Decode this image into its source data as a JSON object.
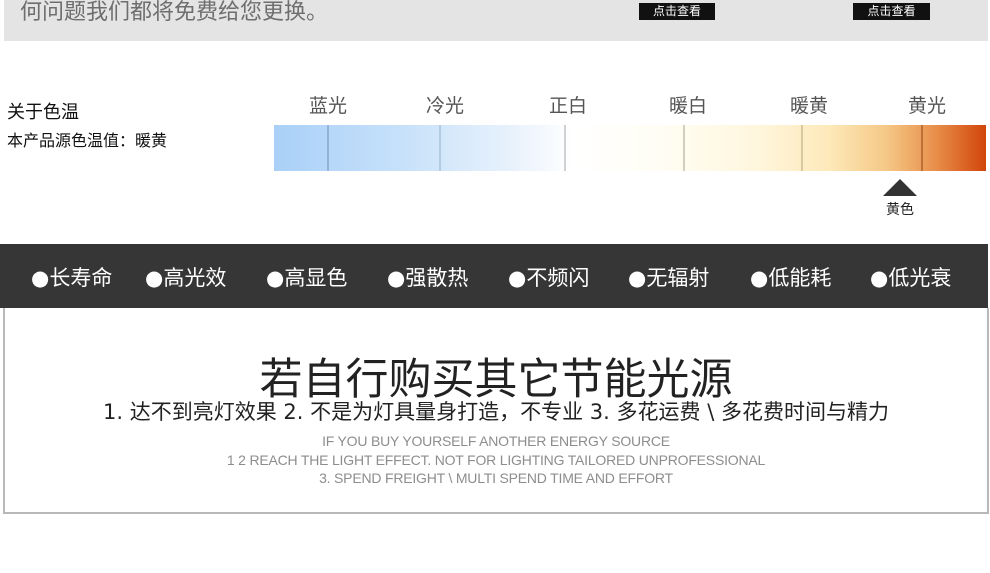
{
  "banner": {
    "text": "何问题我们都将免费给您更换。",
    "view_buttons": [
      "点击查看",
      "点击查看"
    ]
  },
  "color_temperature": {
    "title": "关于色温",
    "product_label": "本产品源色温值：暖黄",
    "labels": [
      "蓝光",
      "冷光",
      "正白",
      "暖白",
      "暖黄",
      "黄光"
    ],
    "marker_label": "黄色",
    "gradient_colors": [
      "#a9d0f8",
      "#ffffff",
      "#fde9b9",
      "#d1450a"
    ]
  },
  "features": [
    "●长寿命",
    "●高光效",
    "●高显色",
    "●强散热",
    "●不频闪",
    "●无辐射",
    "●低能耗",
    "●低光衰"
  ],
  "info": {
    "heading": "若自行购买其它节能光源",
    "points": "1. 达不到亮灯效果   2. 不是为灯具量身打造，不专业  3. 多花运费 \\ 多花费时间与精力",
    "english_lines": [
      "IF YOU BUY YOURSELF ANOTHER ENERGY SOURCE",
      "1 2 REACH THE LIGHT EFFECT. NOT FOR LIGHTING TAILORED UNPROFESSIONAL",
      "3. SPEND FREIGHT \\ MULTI SPEND TIME AND EFFORT"
    ]
  }
}
